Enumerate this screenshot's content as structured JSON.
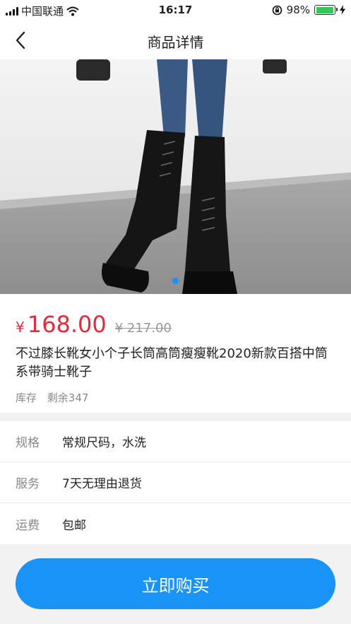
{
  "status_bar": {
    "carrier": "中国联通",
    "time": "16:17",
    "battery_percent": "98%",
    "battery_level": 0.98,
    "icons": [
      "signal-icon",
      "wifi-icon",
      "orientation-lock-icon",
      "battery-icon",
      "charging-icon"
    ]
  },
  "nav": {
    "title": "商品详情",
    "back_icon": "chevron-left-icon"
  },
  "gallery": {
    "image": "knee-high-black-lace-up-boots-photo",
    "current_index": 1,
    "total": 1
  },
  "product": {
    "currency": "¥",
    "price": "168.00",
    "original_price": "¥ 217.00",
    "title": "不过膝长靴女小个子长筒高筒瘦瘦靴2020新款百搭中筒系带骑士靴子",
    "stock_label": "库存",
    "stock_remaining": "剩余347"
  },
  "attributes": [
    {
      "label": "规格",
      "value": "常规尺码，水洗"
    },
    {
      "label": "服务",
      "value": "7天无理由退货"
    },
    {
      "label": "运费",
      "value": "包邮"
    }
  ],
  "actions": {
    "buy_now": "立即购买"
  },
  "colors": {
    "price_red": "#e8293c",
    "accent_blue": "#1993f5",
    "battery_green": "#34c759"
  }
}
